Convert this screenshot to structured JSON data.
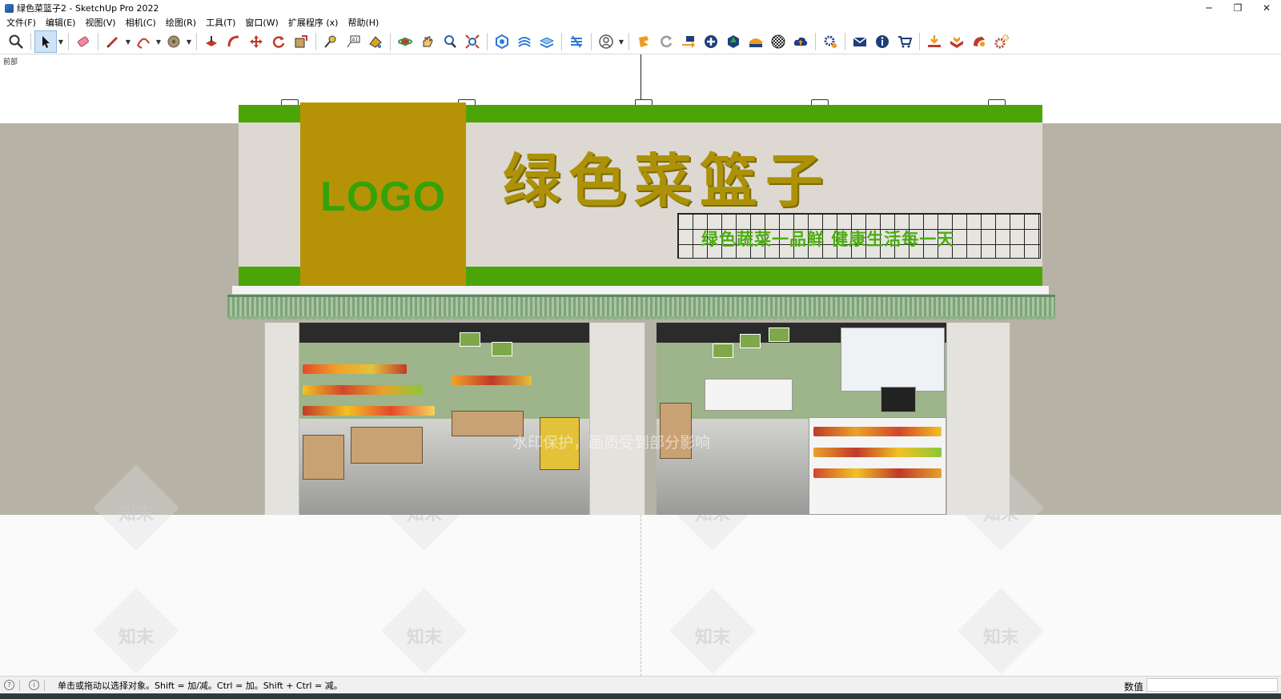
{
  "window": {
    "title": "绿色菜篮子2 - SketchUp Pro 2022",
    "controls": {
      "minimize": "─",
      "restore": "❐",
      "close": "✕"
    }
  },
  "menu": [
    "文件(F)",
    "编辑(E)",
    "视图(V)",
    "相机(C)",
    "绘图(R)",
    "工具(T)",
    "窗口(W)",
    "扩展程序 (x)",
    "帮助(H)"
  ],
  "toolbar": {
    "icons": [
      "zoom-icon",
      "select-icon",
      "eraser-icon",
      "pencil-icon",
      "arc-icon",
      "paint-bucket-icon",
      "push-pull-icon",
      "follow-me-icon",
      "move-icon",
      "rotate-icon",
      "scale-icon",
      "tape-measure-icon",
      "text-icon",
      "paint-icon",
      "orbit-icon",
      "pan-icon",
      "zoom-window-icon",
      "zoom-extents-icon",
      "warehouse-icon",
      "components-icon",
      "layers-icon",
      "outliner-icon",
      "user-icon",
      "extension-icon",
      "refresh-icon",
      "export-icon",
      "add-icon",
      "tree-icon",
      "section-icon",
      "checker-icon",
      "cloud-upload-icon",
      "gear-icon",
      "mail-icon",
      "info-icon",
      "cart-icon",
      "import-icon",
      "plugin-icon",
      "plugin2-icon",
      "settings-icon"
    ]
  },
  "viewport": {
    "scene_label": "前部",
    "sign": {
      "logo": "LOGO",
      "title": "绿色菜篮子",
      "slogan": "绿色蔬菜一品鲜  健康生活每一天"
    },
    "watermark": {
      "brand": "知末",
      "caption": "水印保护，画质受到部分影响"
    }
  },
  "status": {
    "message": "单击或拖动以选择对象。Shift = 加/减。Ctrl = 加。Shift + Ctrl = 减。",
    "measurements_label": "数值",
    "measurements_value": ""
  },
  "colors": {
    "sign_green": "#4ca508",
    "logo_gold": "#b69306",
    "title_gold": "#ad9107",
    "wall": "#b6b3a6"
  }
}
